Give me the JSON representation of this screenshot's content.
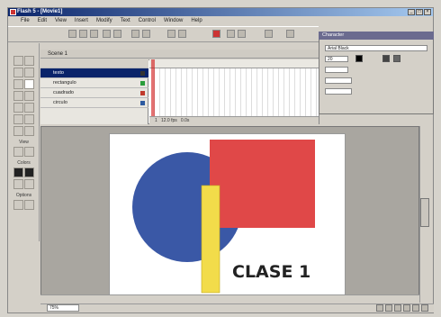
{
  "window": {
    "title": "Flash 5 - [Movie1]",
    "controls": [
      "_",
      "□",
      "×"
    ]
  },
  "menubar": {
    "items": [
      "File",
      "Edit",
      "View",
      "Insert",
      "Modify",
      "Text",
      "Control",
      "Window",
      "Help"
    ]
  },
  "toolbar": {
    "icons": [
      "new-icon",
      "open-icon",
      "save-icon",
      "print-icon",
      "cut-icon",
      "copy-icon",
      "paste-icon",
      "undo-icon",
      "redo-icon",
      "snap-icon",
      "smooth-icon",
      "straighten-icon",
      "rotate-icon",
      "scale-icon"
    ]
  },
  "toolbox": {
    "view_label": "View",
    "colors_label": "Colors",
    "options_label": "Options"
  },
  "scene": {
    "label": "Scene 1"
  },
  "timeline": {
    "layers": [
      {
        "name": "texto",
        "color": "#333333",
        "selected": true
      },
      {
        "name": "rectangulo",
        "color": "#2a9d3a",
        "selected": false
      },
      {
        "name": "cuadrado",
        "color": "#c0392b",
        "selected": false
      },
      {
        "name": "circulo",
        "color": "#2c5aa0",
        "selected": false
      }
    ],
    "frame": "1",
    "fps": "12.0 fps",
    "time": "0.0s"
  },
  "properties": {
    "title": "Character",
    "font": "Arial Black",
    "size": "20",
    "colors": {
      "stroke": "#000000",
      "fill": "#000000"
    }
  },
  "stage": {
    "text": "CLASE 1",
    "colors": {
      "circle": "#3a58a6",
      "square": "#e04848",
      "rectangle": "#f2dc4a"
    }
  },
  "status": {
    "zoom": "75%"
  }
}
